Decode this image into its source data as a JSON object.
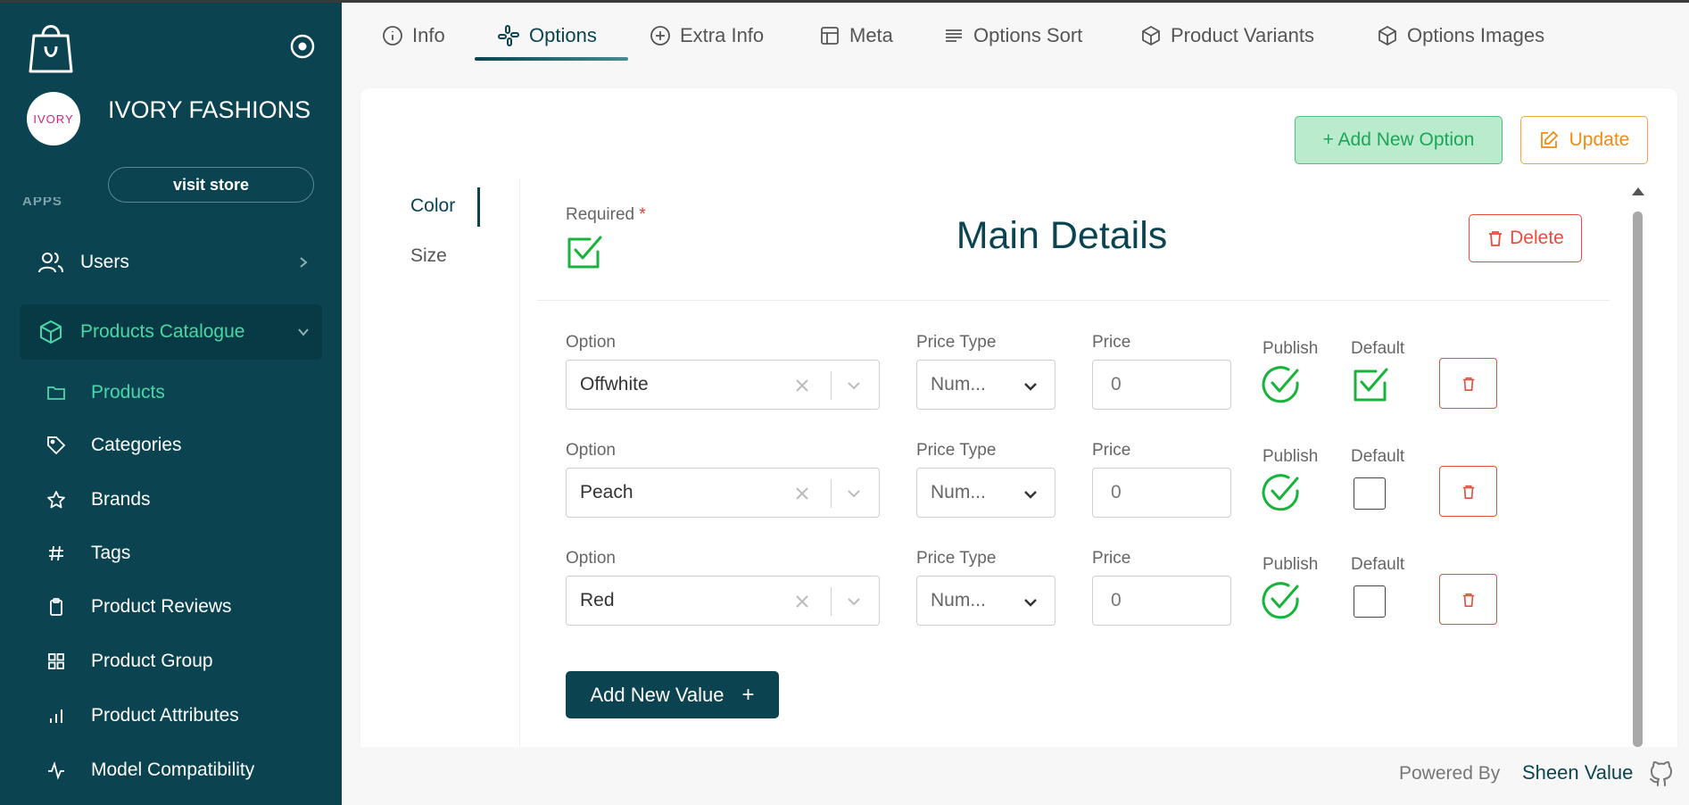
{
  "sidebar": {
    "brand_name": "IVORY FASHIONS",
    "brand_logo_text": "IVORY",
    "visit_store": "visit store",
    "section_label": "APPS",
    "nav": {
      "users": "Users",
      "catalog": "Products Catalogue"
    },
    "sub_items": [
      {
        "label": "Products",
        "icon": "folder-icon",
        "active": true
      },
      {
        "label": "Categories",
        "icon": "tag-icon"
      },
      {
        "label": "Brands",
        "icon": "star-icon"
      },
      {
        "label": "Tags",
        "icon": "hash-icon"
      },
      {
        "label": "Product Reviews",
        "icon": "clipboard-icon"
      },
      {
        "label": "Product Group",
        "icon": "grid-icon"
      },
      {
        "label": "Product Attributes",
        "icon": "bar-chart-icon"
      },
      {
        "label": "Model Compatibility",
        "icon": "activity-icon"
      }
    ]
  },
  "tabs": [
    {
      "label": "Info",
      "icon": "info-icon"
    },
    {
      "label": "Options",
      "icon": "options-icon",
      "active": true
    },
    {
      "label": "Extra Info",
      "icon": "plus-circle-icon"
    },
    {
      "label": "Meta",
      "icon": "layout-icon"
    },
    {
      "label": "Options Sort",
      "icon": "lines-icon"
    },
    {
      "label": "Product Variants",
      "icon": "box-icon"
    },
    {
      "label": "Options Images",
      "icon": "box-icon"
    }
  ],
  "actions": {
    "add_option": "+ Add New Option",
    "update": "Update"
  },
  "option_groups": [
    {
      "label": "Color",
      "active": true
    },
    {
      "label": "Size"
    }
  ],
  "details": {
    "required_label": "Required",
    "required_star": "*",
    "required_checked": true,
    "title": "Main Details",
    "delete": "Delete"
  },
  "columns": {
    "option": "Option",
    "price_type": "Price Type",
    "price": "Price",
    "publish": "Publish",
    "default": "Default"
  },
  "rows": [
    {
      "option": "Offwhite",
      "price_type": "Num...",
      "price": "0",
      "publish": true,
      "default": true
    },
    {
      "option": "Peach",
      "price_type": "Num...",
      "price": "0",
      "publish": true,
      "default": false
    },
    {
      "option": "Red",
      "price_type": "Num...",
      "price": "0",
      "publish": true,
      "default": false
    }
  ],
  "add_value": "Add New Value",
  "add_value_plus": "+",
  "footer": {
    "powered_by": "Powered By",
    "company": "Sheen Value"
  },
  "colors": {
    "primary": "#0b4450",
    "accent": "#4cd6a8",
    "success": "#1ea55a",
    "warning": "#f08c13",
    "danger": "#e74c3c"
  }
}
